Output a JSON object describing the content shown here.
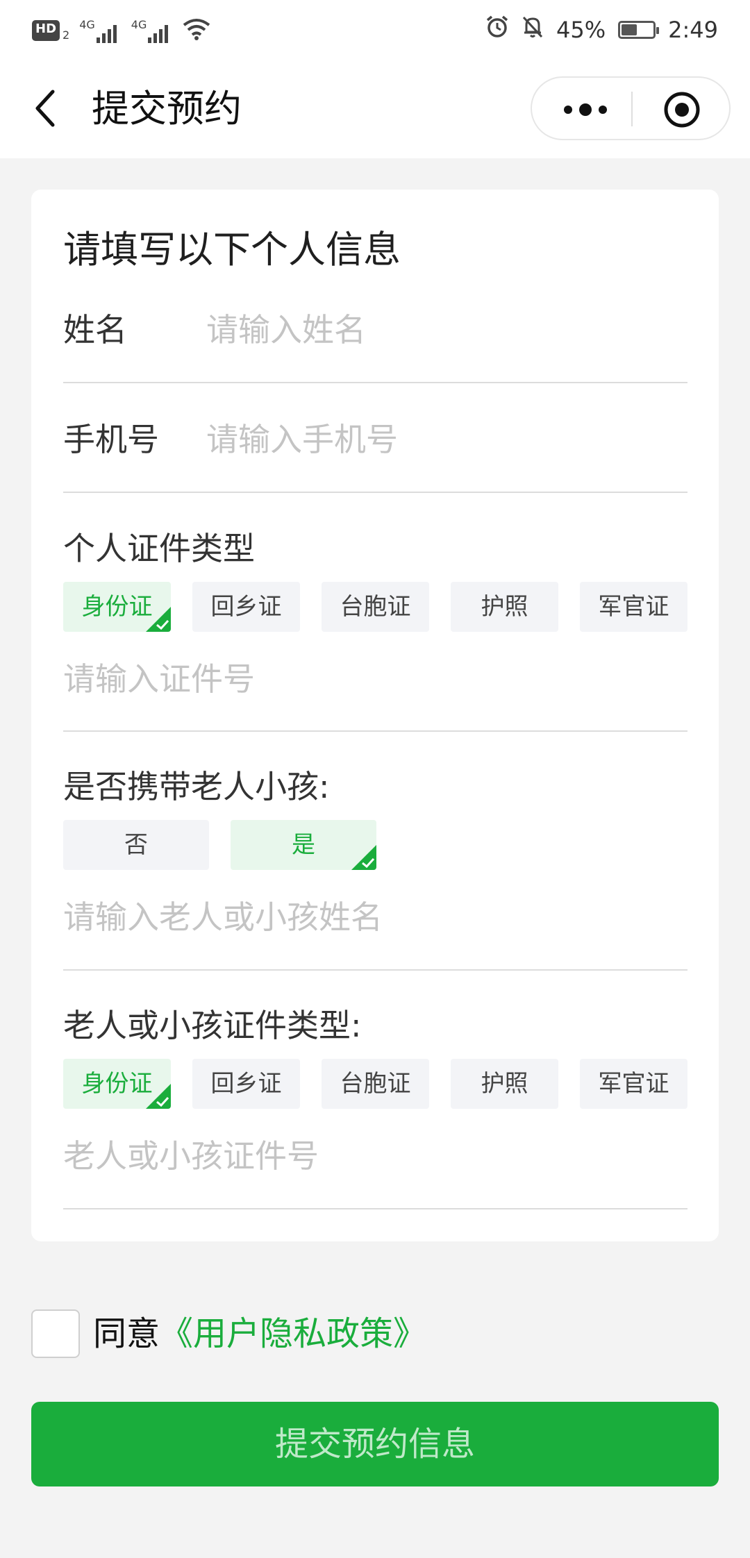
{
  "status_bar": {
    "hd": "HD",
    "hd_sub": "2",
    "net1": "4G",
    "net2": "4G",
    "battery": "45%",
    "time": "2:49"
  },
  "nav": {
    "title": "提交预约"
  },
  "form": {
    "section_title": "请填写以下个人信息",
    "name_label": "姓名",
    "name_placeholder": "请输入姓名",
    "phone_label": "手机号",
    "phone_placeholder": "请输入手机号",
    "id_type_label": "个人证件类型",
    "id_types": [
      "身份证",
      "回乡证",
      "台胞证",
      "护照",
      "军官证"
    ],
    "id_selected": 0,
    "id_number_placeholder": "请输入证件号",
    "companion_label": "是否携带老人小孩:",
    "companion_options": [
      "否",
      "是"
    ],
    "companion_selected": 1,
    "companion_name_placeholder": "请输入老人或小孩姓名",
    "companion_id_type_label": "老人或小孩证件类型:",
    "companion_id_types": [
      "身份证",
      "回乡证",
      "台胞证",
      "护照",
      "军官证"
    ],
    "companion_id_selected": 0,
    "companion_id_placeholder": "老人或小孩证件号"
  },
  "agree": {
    "text": "同意",
    "link": "《用户隐私政策》"
  },
  "submit_label": "提交预约信息",
  "colors": {
    "accent": "#1aad3c",
    "chip_selected_bg": "#e8f7ec",
    "chip_bg": "#f3f4f7",
    "placeholder": "#c4c4c4"
  }
}
